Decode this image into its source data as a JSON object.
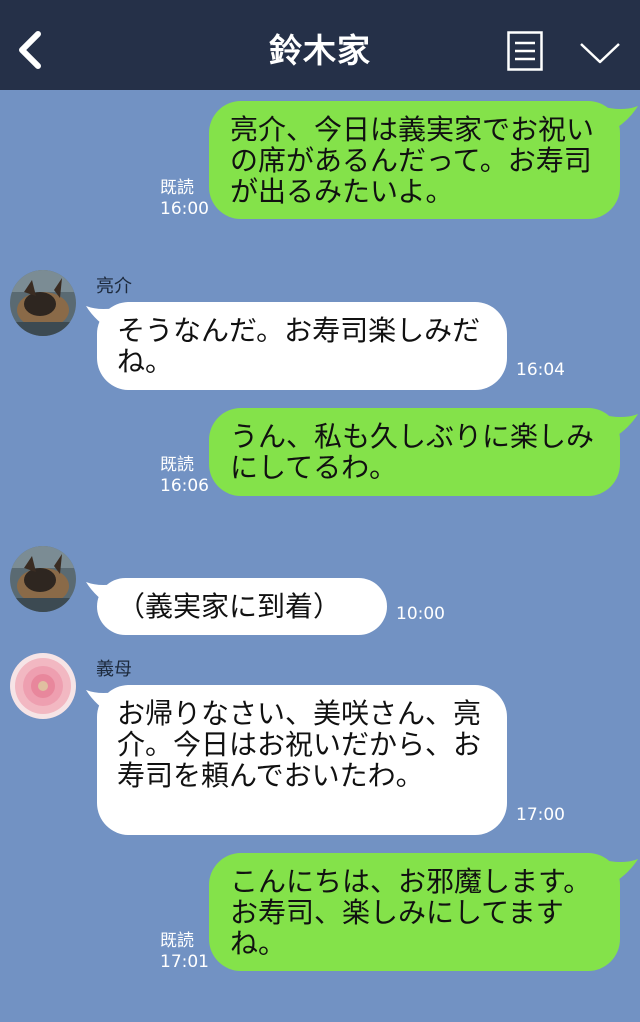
{
  "header": {
    "title": "鈴木家"
  },
  "messages": [
    {
      "side": "me",
      "text": "亮介、今日は義実家でお祝いの席があるんだって。お寿司が出るみたいよ。",
      "read": "既読",
      "time": "16:00"
    },
    {
      "side": "them",
      "sender": "亮介",
      "text": "そうなんだ。お寿司楽しみだね。",
      "time": "16:04"
    },
    {
      "side": "me",
      "text": "うん、私も久しぶりに楽しみにしてるわ。",
      "read": "既読",
      "time": "16:06"
    },
    {
      "side": "them",
      "sender": "",
      "text": "（義実家に到着）",
      "time": "10:00"
    },
    {
      "side": "them",
      "sender": "義母",
      "text": "お帰りなさい、美咲さん、亮介。今日はお祝いだから、お寿司を頼んでおいたわ。",
      "time": "17:00"
    },
    {
      "side": "me",
      "text": "こんにちは、お邪魔します。お寿司、楽しみにしてますね。",
      "read": "既読",
      "time": "17:01"
    }
  ],
  "icons": {
    "back": "chevron-left-icon",
    "menu": "notes-icon",
    "collapse": "chevron-down-icon"
  },
  "colors": {
    "background": "#7292c3",
    "header": "#253048",
    "my_bubble": "#84e24a",
    "their_bubble": "#ffffff"
  }
}
